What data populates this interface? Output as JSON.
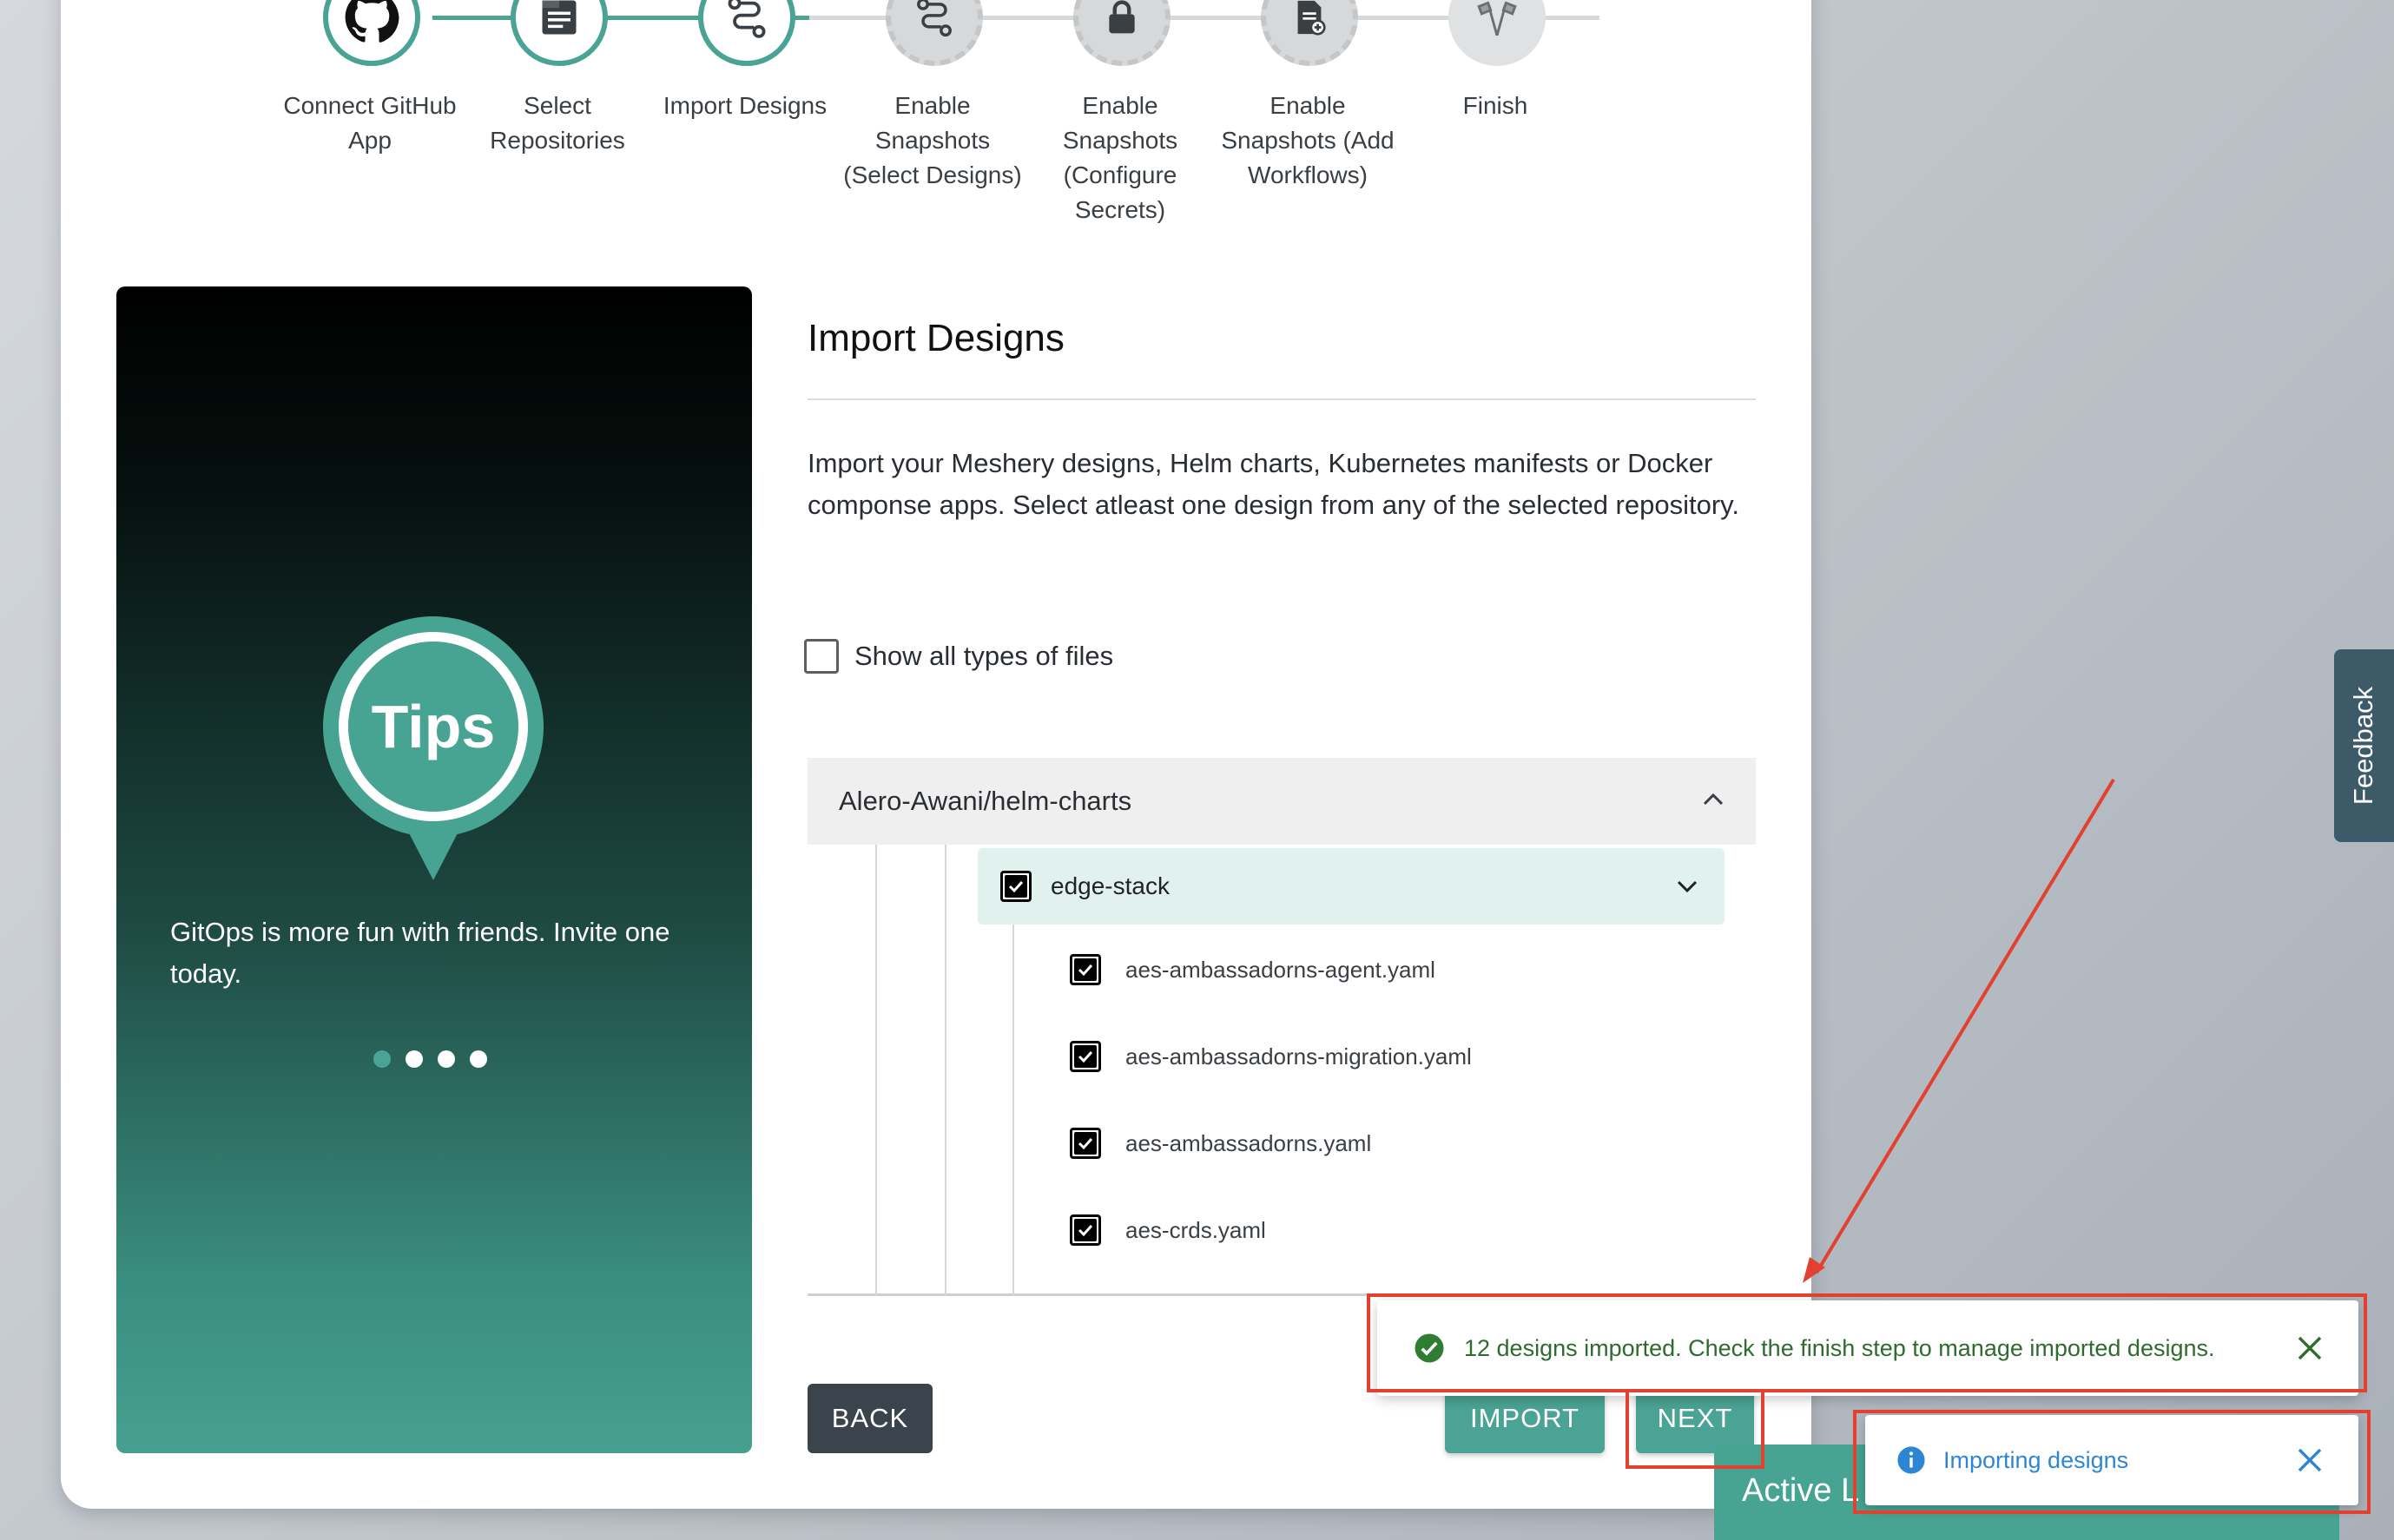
{
  "stepper": {
    "steps": [
      {
        "label": "Connect GitHub App",
        "state": "done",
        "icon": "github-icon"
      },
      {
        "label": "Select Repositories",
        "state": "done",
        "icon": "folder-icon"
      },
      {
        "label": "Import Designs",
        "state": "active",
        "icon": "import-icon"
      },
      {
        "label": "Enable Snapshots (Select Designs)",
        "state": "pending",
        "icon": "workflow-settings-icon"
      },
      {
        "label": "Enable Snapshots (Configure Secrets)",
        "state": "pending",
        "icon": "lock-icon"
      },
      {
        "label": "Enable Snapshots (Add Workflows)",
        "state": "pending",
        "icon": "document-add-icon"
      },
      {
        "label": "Finish",
        "state": "pending",
        "icon": "checkered-flags-icon"
      }
    ],
    "labels": {
      "s1a": "Connect GitHub",
      "s1b": "App",
      "s2a": "Select",
      "s2b": "Repositories",
      "s3a": "Import Designs",
      "s4a": "Enable",
      "s4b": "Snapshots",
      "s4c": "(Select Designs)",
      "s5a": "Enable",
      "s5b": "Snapshots",
      "s5c": "(Configure",
      "s5d": "Secrets)",
      "s6a": "Enable",
      "s6b": "Snapshots (Add",
      "s6c": "Workflows)",
      "s7a": "Finish"
    },
    "colors": {
      "done": "#4aa394",
      "pending": "#d6d8da"
    }
  },
  "tips": {
    "badge": "Tips",
    "text": "GitOps is more fun with friends. Invite one today.",
    "dots_total": 4,
    "dots_active_index": 0
  },
  "main": {
    "title": "Import Designs",
    "description": "Import your Meshery designs, Helm charts, Kubernetes manifests or Docker componse apps. Select atleast one design from any of the selected repository.",
    "show_all_label": "Show all types of files",
    "show_all_checked": false,
    "repo": {
      "name": "Alero-Awani/helm-charts",
      "expanded": true,
      "folder": {
        "name": "edge-stack",
        "checked": true
      },
      "files": [
        {
          "name": "aes-ambassadorns-agent.yaml",
          "checked": true
        },
        {
          "name": "aes-ambassadorns-migration.yaml",
          "checked": true
        },
        {
          "name": "aes-ambassadorns.yaml",
          "checked": true
        },
        {
          "name": "aes-crds.yaml",
          "checked": true
        }
      ]
    }
  },
  "buttons": {
    "back": "BACK",
    "import": "IMPORT",
    "next": "NEXT"
  },
  "active_tab": "Active L",
  "feedback": "Feedback",
  "toasts": {
    "success": "12 designs imported. Check the finish step to manage imported designs.",
    "info": "Importing designs"
  },
  "colors": {
    "accent": "#4aa394",
    "annotation": "#e2412f",
    "success": "#2e7d32",
    "info": "#2c86d4"
  }
}
